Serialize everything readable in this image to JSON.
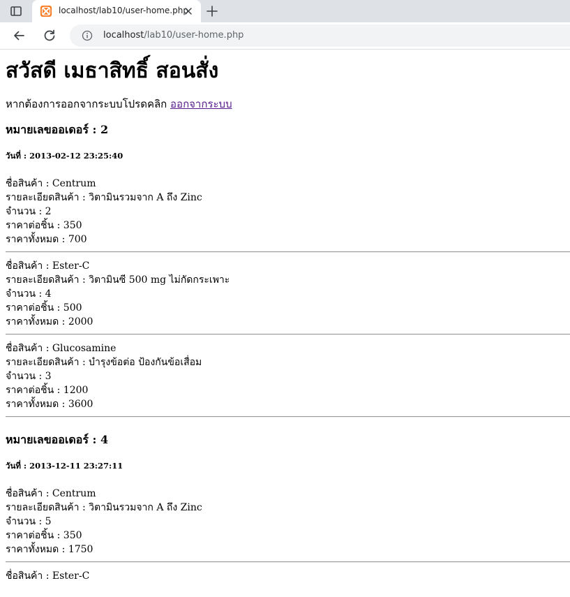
{
  "browser": {
    "tab_title": "localhost/lab10/user-home.php",
    "url_host": "localhost",
    "url_path": "/lab10/user-home.php",
    "icons": {
      "tab_toggle": "sidebar-icon",
      "favicon": "xampp-icon",
      "close": "close-icon",
      "new_tab": "plus-icon",
      "back": "back-arrow-icon",
      "reload": "reload-icon",
      "info": "info-icon"
    },
    "favicon_color": "#fb7a24"
  },
  "page": {
    "greeting": "สวัสดี เมธาสิทธิ์ สอนสั่ง",
    "logout_prompt": "หากต้องการออกจากระบบโปรดคลิก",
    "logout_link": "ออกจากระบบ"
  },
  "orders": [
    {
      "order_label": "หมายเลขออเดอร์ : 2",
      "date_label": "วันที่ : 2013-02-12 23:25:40",
      "items": [
        {
          "name": "ชื่อสินค้า : Centrum",
          "detail": "รายละเอียดสินค้า : วิตามินรวมจาก A ถึง Zinc",
          "qty": "จำนวน : 2",
          "unit_price": "ราคาต่อชิ้น : 350",
          "total": "ราคาทั้งหมด : 700"
        },
        {
          "name": "ชื่อสินค้า : Ester-C",
          "detail": "รายละเอียดสินค้า : วิตามินซี 500 mg ไม่กัดกระเพาะ",
          "qty": "จำนวน : 4",
          "unit_price": "ราคาต่อชิ้น : 500",
          "total": "ราคาทั้งหมด : 2000"
        },
        {
          "name": "ชื่อสินค้า : Glucosamine",
          "detail": "รายละเอียดสินค้า : บำรุงข้อต่อ ป้องกันข้อเสื่อม",
          "qty": "จำนวน : 3",
          "unit_price": "ราคาต่อชิ้น : 1200",
          "total": "ราคาทั้งหมด : 3600"
        }
      ]
    },
    {
      "order_label": "หมายเลขออเดอร์ : 4",
      "date_label": "วันที่ : 2013-12-11 23:27:11",
      "items": [
        {
          "name": "ชื่อสินค้า : Centrum",
          "detail": "รายละเอียดสินค้า : วิตามินรวมจาก A ถึง Zinc",
          "qty": "จำนวน : 5",
          "unit_price": "ราคาต่อชิ้น : 350",
          "total": "ราคาทั้งหมด : 1750"
        },
        {
          "name": "ชื่อสินค้า : Ester-C"
        }
      ]
    }
  ]
}
